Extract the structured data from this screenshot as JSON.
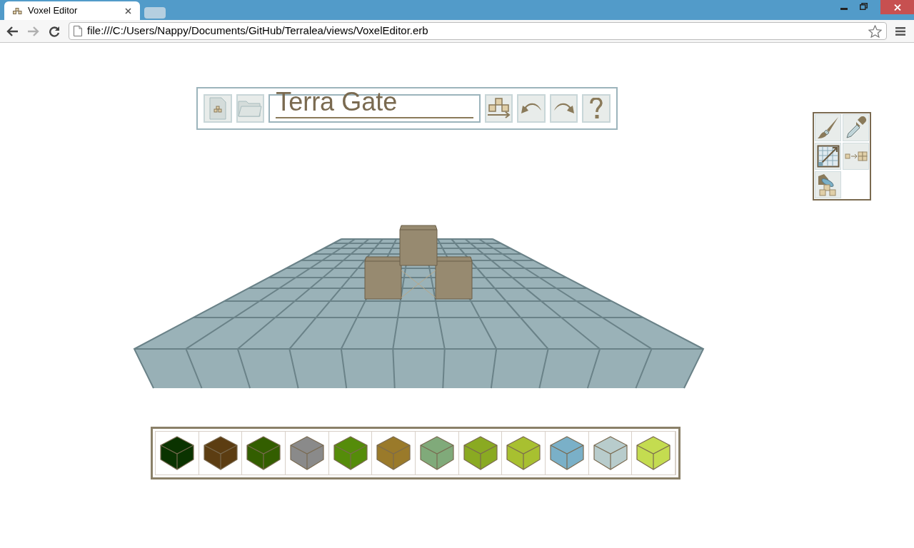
{
  "browser": {
    "tab_title": "Voxel Editor",
    "address": "file:///C:/Users/Nappy/Documents/GitHub/Terralea/views/VoxelEditor.erb"
  },
  "toolbar": {
    "name_field": "Terra Gate"
  },
  "palette": [
    {
      "color": "#0a3300"
    },
    {
      "color": "#5c3d12"
    },
    {
      "color": "#335e00"
    },
    {
      "color": "#8a8a8a"
    },
    {
      "color": "#558c0a"
    },
    {
      "color": "#9a7a2a"
    },
    {
      "color": "#80aa7a"
    },
    {
      "color": "#8aaa22"
    },
    {
      "color": "#a8c030"
    },
    {
      "color": "#7ab0c8"
    },
    {
      "color": "#b8cccc"
    },
    {
      "color": "#c4dc50"
    }
  ]
}
